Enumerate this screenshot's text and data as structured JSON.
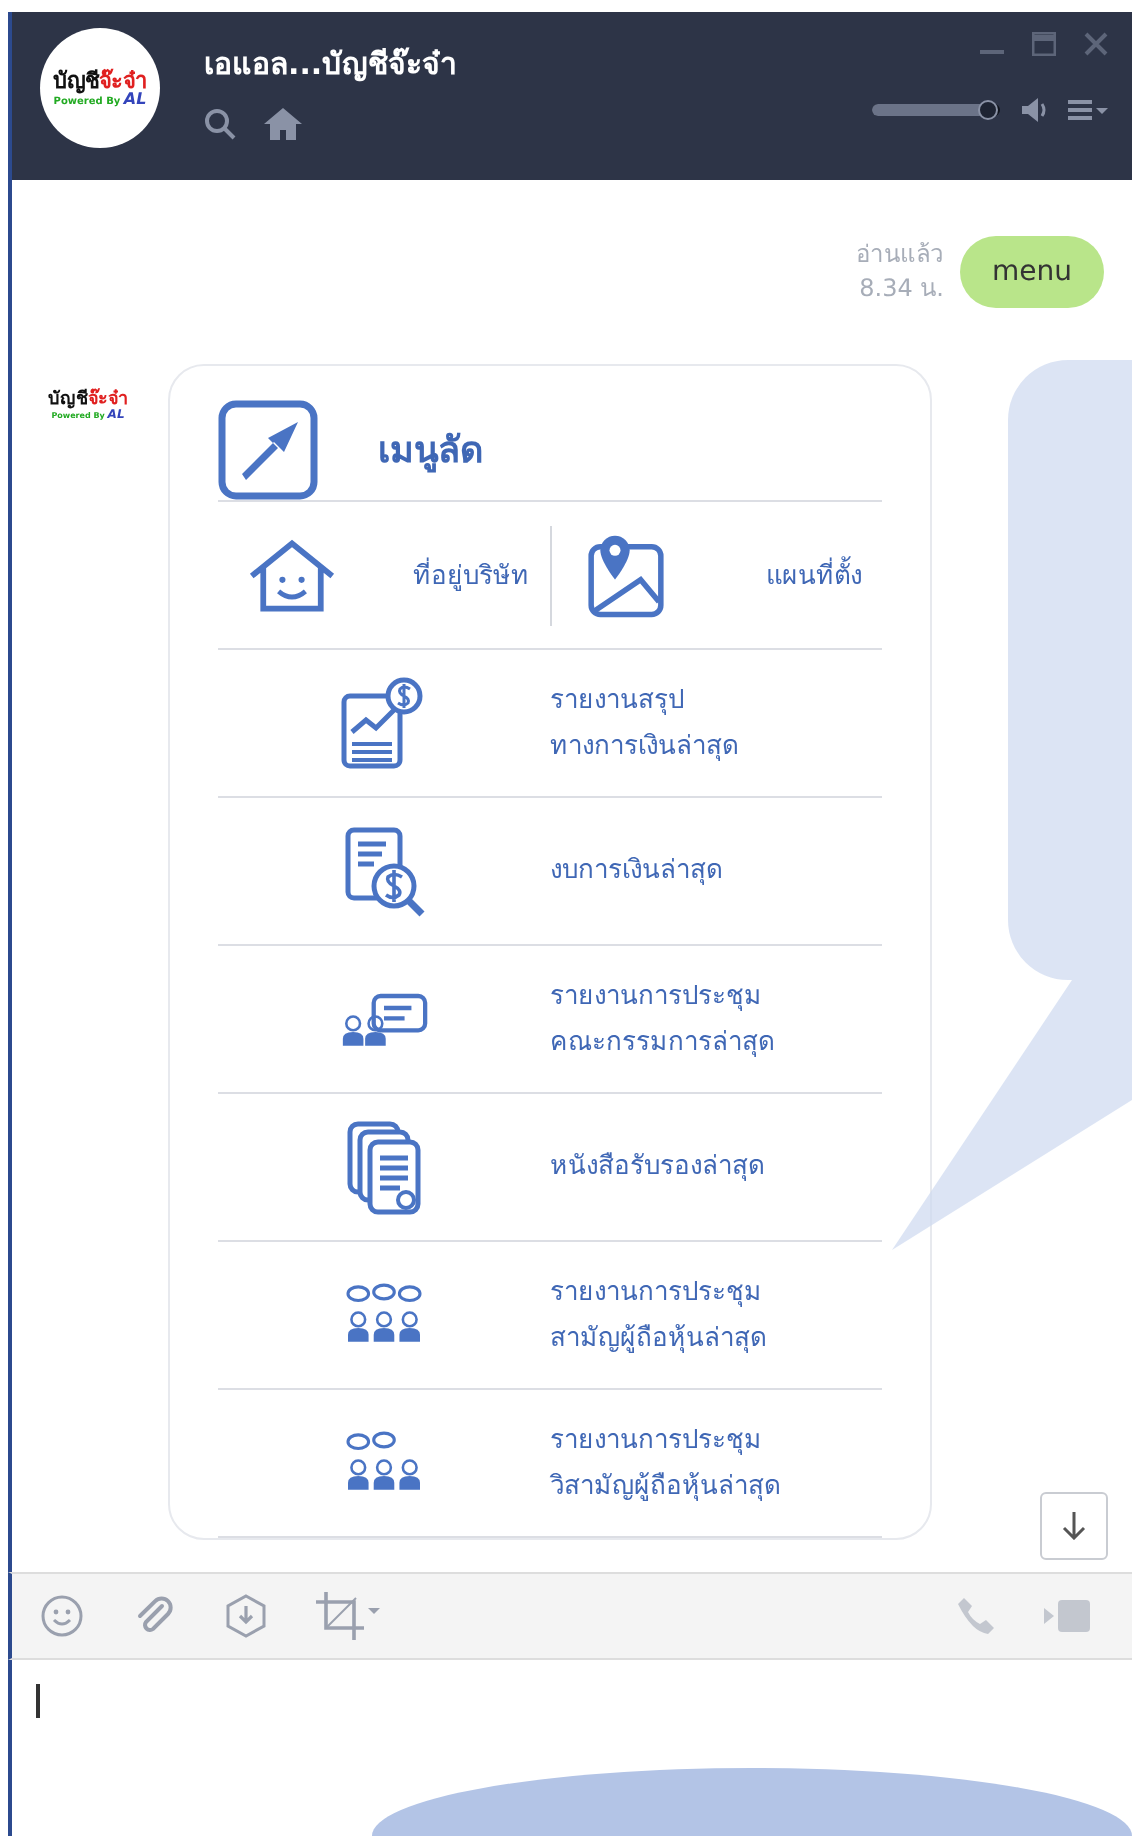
{
  "window": {
    "title": "เอแอล...บัญชีจ๊ะจ๋า",
    "logo": {
      "name": "บัญชี",
      "name_accent": "จ๊ะจ๋า",
      "tagline": "Powered By",
      "mark": "AL"
    },
    "volume": {
      "level": 0.9
    }
  },
  "messages": [
    {
      "kind": "sent",
      "text": "menu",
      "status": "อ่านแล้ว",
      "time": "8.34 น."
    },
    {
      "kind": "card",
      "sender_logo": {
        "name": "บัญชี",
        "name_accent": "จ๊ะจ๋า",
        "tagline": "Powered By",
        "mark": "AL"
      },
      "title": "เมนูลัด",
      "pair": [
        {
          "kind": "house",
          "label": "ที่อยู่บริษัท"
        },
        {
          "kind": "map",
          "label": "แผนที่ตั้ง"
        }
      ],
      "items": [
        {
          "kind": "report",
          "lines": [
            "รายงานสรุป",
            "ทางการเงินล่าสุด"
          ]
        },
        {
          "kind": "statement",
          "lines": [
            "งบการเงินล่าสุด"
          ]
        },
        {
          "kind": "committee",
          "lines": [
            "รายงานการประชุม",
            "คณะกรรมการล่าสุด"
          ]
        },
        {
          "kind": "certificate",
          "lines": [
            "หนังสือรับรองล่าสุด"
          ]
        },
        {
          "kind": "shareholders",
          "lines": [
            "รายงานการประชุม",
            "สามัญผู้ถือหุ้นล่าสุด"
          ]
        },
        {
          "kind": "extraordinary",
          "lines": [
            "รายงานการประชุม",
            "วิสามัญผู้ถือหุ้นล่าสุด"
          ]
        }
      ]
    }
  ]
}
